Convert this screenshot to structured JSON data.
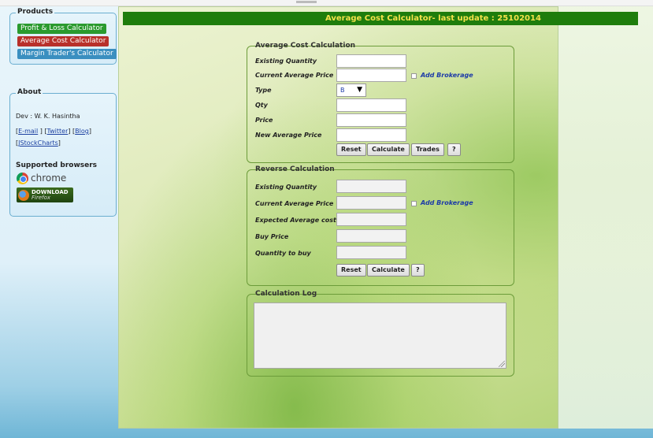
{
  "header": {
    "title": "Average Cost Calculator- last update : 25102014"
  },
  "sidebar": {
    "products": {
      "legend": "Products",
      "items": [
        {
          "label": "Profit & Loss Calculator",
          "color": "#2a9a2e"
        },
        {
          "label": "Average Cost Calculator",
          "color": "#b8302a"
        },
        {
          "label": "Margin Trader's Calculator",
          "color": "#3a8fc0"
        }
      ]
    },
    "about": {
      "legend": "About",
      "dev": "Dev : W. K. Hasintha",
      "links": {
        "email": "E-mail",
        "twitter": "Twitter",
        "blog": "Blog",
        "jstock": "JStockCharts"
      },
      "browsers_label": "Supported browsers",
      "chrome": "chrome",
      "firefox_line1": "DOWNLOAD",
      "firefox_line2": "Firefox"
    }
  },
  "average_calc": {
    "legend": "Average Cost Calculation",
    "labels": {
      "existing_qty": "Existing Quantity",
      "current_avg": "Current Average Price",
      "type": "Type",
      "qty": "Qty",
      "price": "Price",
      "new_avg": "New Average Price"
    },
    "add_brokerage": "Add Brokerage",
    "type_value": "B",
    "buttons": {
      "reset": "Reset",
      "calculate": "Calculate",
      "trades": "Trades",
      "help": "?"
    }
  },
  "reverse_calc": {
    "legend": "Reverse Calculation",
    "labels": {
      "existing_qty": "Existing Quantity",
      "current_avg": "Current Average Price",
      "expected_avg": "Expected Average cost",
      "buy_price": "Buy Price",
      "qty_to_buy": "Quantity to buy"
    },
    "add_brokerage": "Add Brokerage",
    "buttons": {
      "reset": "Reset",
      "calculate": "Calculate",
      "help": "?"
    }
  },
  "calc_log": {
    "legend": "Calculation Log"
  },
  "colors": {
    "header_bg": "#1e7d0c",
    "header_text": "#f3e24a",
    "panel_border": "#6aaed0"
  }
}
